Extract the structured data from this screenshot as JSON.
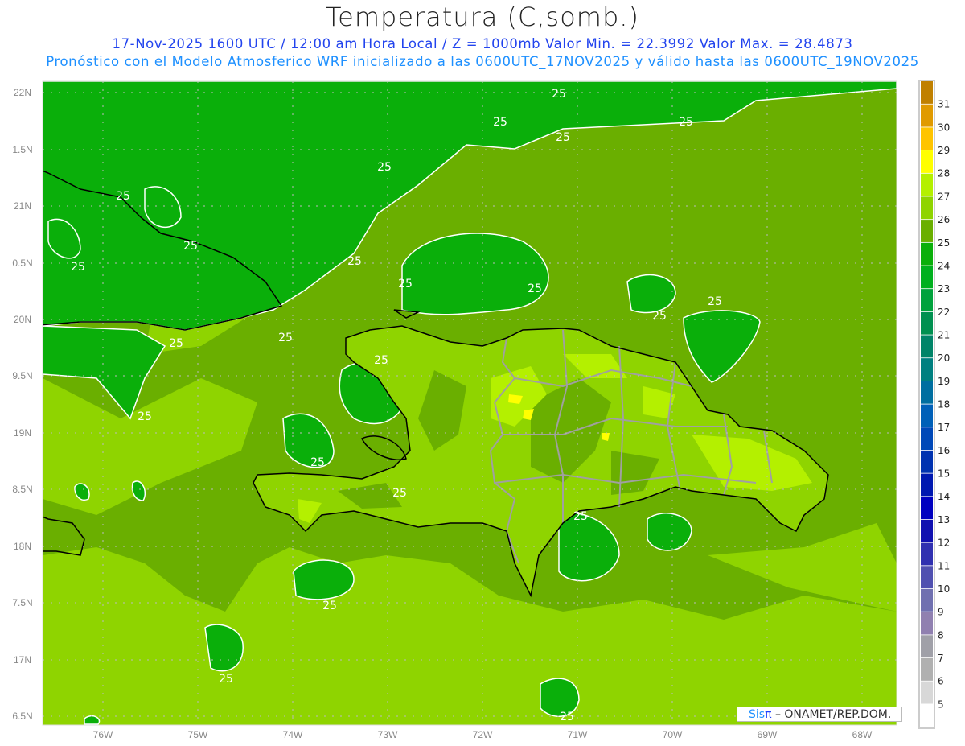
{
  "header": {
    "title": "Temperatura (C,somb.)",
    "subtitle_line1": "17-Nov-2025 1600 UTC / 12:00 am Hora Local / Z = 1000mb  Valor Min. = 22.3992  Valor Max. = 28.4873",
    "subtitle_line2": "Pronóstico con el Modelo Atmosferico WRF inicializado a las 0600UTC_17NOV2025 y válido hasta las  0600UTC_19NOV2025"
  },
  "map": {
    "lat_labels": [
      "22N",
      "1.5N",
      "21N",
      "0.5N",
      "20N",
      "9.5N",
      "19N",
      "8.5N",
      "18N",
      "7.5N",
      "17N",
      "6.5N"
    ],
    "lon_labels": [
      "76W",
      "75W",
      "74W",
      "73W",
      "72W",
      "71W",
      "70W",
      "69W",
      "68W"
    ],
    "contour_labels": [
      "25",
      "25",
      "25",
      "25",
      "25",
      "25",
      "25",
      "25",
      "25",
      "25",
      "25",
      "25",
      "25",
      "25",
      "25",
      "25",
      "25",
      "25",
      "25",
      "25",
      "25",
      "25",
      "25"
    ],
    "fill_colors": {
      "lt24": "#0aaf0a",
      "t25": "#6aaf00",
      "t26": "#8fd400",
      "t27": "#b4f000",
      "t28": "#ffff00"
    }
  },
  "colorbar": {
    "colors": [
      "#c08000",
      "#e09a00",
      "#ffc400",
      "#ffff00",
      "#b4f000",
      "#8fd400",
      "#6aaf00",
      "#0aaf0a",
      "#00b01e",
      "#00a23c",
      "#009050",
      "#008468",
      "#008080",
      "#006ea0",
      "#0060b8",
      "#0048b8",
      "#0032b0",
      "#0018b0",
      "#0000c0",
      "#1010b0",
      "#3030b0",
      "#5050b0",
      "#7070b0",
      "#9080b0",
      "#a0a0a8",
      "#b0b0b0",
      "#d8d8d8",
      "#ffffff"
    ],
    "labels": [
      "31",
      "30",
      "29",
      "28",
      "27",
      "26",
      "25",
      "24",
      "23",
      "22",
      "21",
      "20",
      "19",
      "18",
      "17",
      "16",
      "15",
      "14",
      "13",
      "12",
      "11",
      "10",
      "9",
      "8",
      "7",
      "6",
      "5"
    ]
  },
  "credit": {
    "sis": "Sis",
    "pi": "π",
    "rest": " –  ONAMET/REP.DOM."
  }
}
